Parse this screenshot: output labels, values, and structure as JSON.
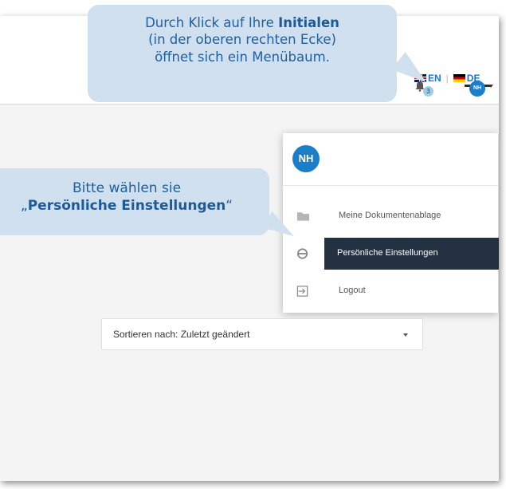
{
  "header": {
    "lang_en": "EN",
    "lang_sep": "|",
    "lang_de": "DE",
    "notification_count": "3",
    "user_initials_small": "NH"
  },
  "menu": {
    "avatar_initials": "NH",
    "items": [
      {
        "label": "Meine Dokumentenablage",
        "icon": "folder-icon"
      },
      {
        "label": "Persönliche Einstellungen",
        "icon": "settings-icon"
      },
      {
        "label": "Logout",
        "icon": "logout-icon"
      }
    ]
  },
  "sort": {
    "label": "Sortieren nach: Zuletzt geändert"
  },
  "callouts": {
    "top": {
      "line1_pre": "Durch Klick auf Ihre ",
      "line1_bold": "Initialen",
      "line2": "(in der oberen rechten Ecke)",
      "line3": "öffnet sich ein Menübaum."
    },
    "left": {
      "line1": "Bitte wählen sie",
      "line2_open": "„",
      "line2_bold": "Persönliche Einstellungen",
      "line2_close": "“"
    }
  },
  "colors": {
    "accent": "#1a7ec8",
    "menu_highlight": "#243142",
    "callout_bg": "#d1e0ef",
    "callout_text": "#1f5fa0"
  }
}
